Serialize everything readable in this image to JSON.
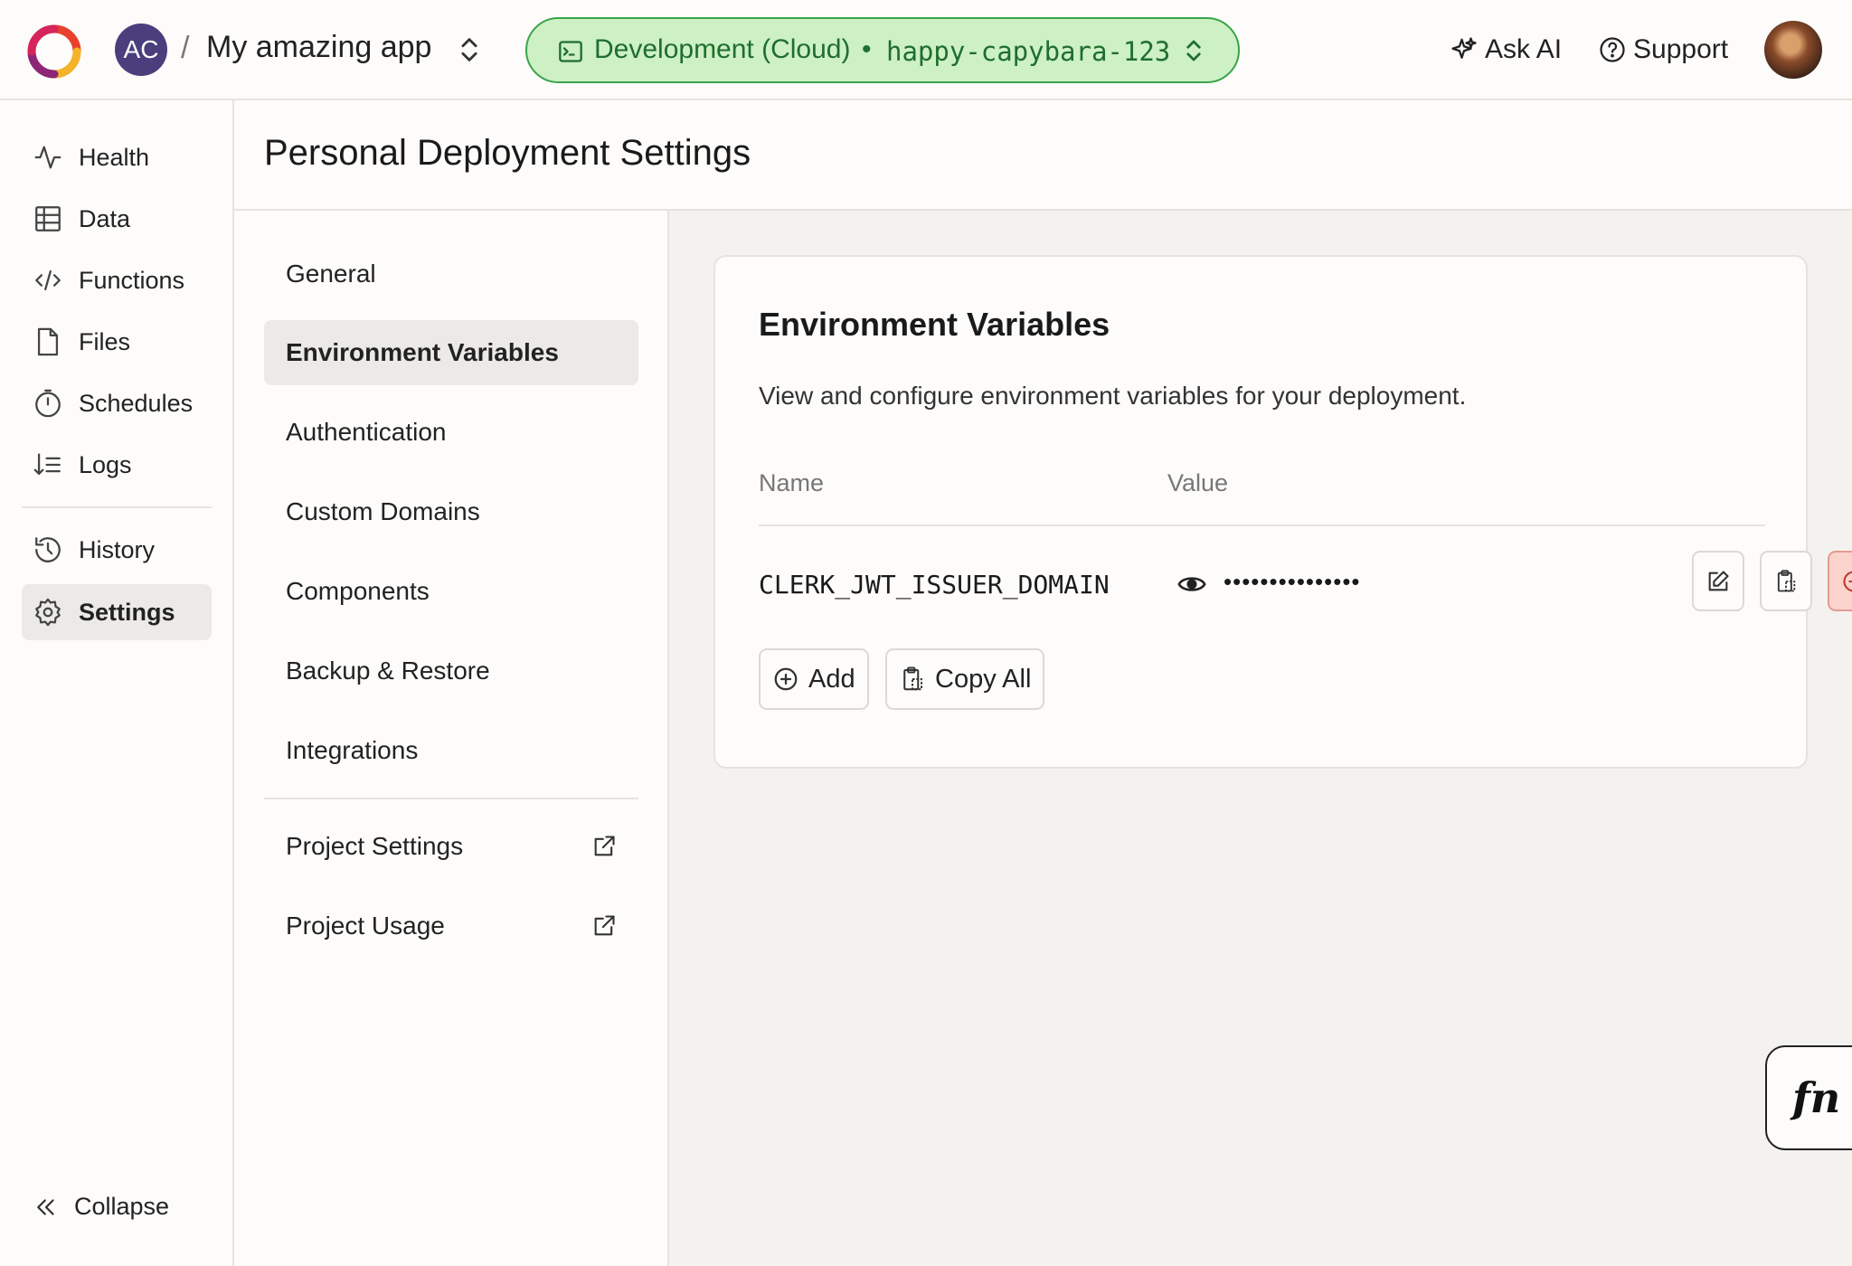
{
  "topbar": {
    "team_initials": "AC",
    "separator": "/",
    "project_name": "My amazing app",
    "deployment": {
      "environment": "Development (Cloud)",
      "bullet": "•",
      "slug": "happy-capybara-123",
      "colors": {
        "background": "#cdf0c5",
        "border": "#3aa348",
        "text": "#1f6e2c"
      }
    },
    "ask_ai_label": "Ask AI",
    "support_label": "Support"
  },
  "sidebar": {
    "items": [
      {
        "label": "Health",
        "icon": "activity-icon"
      },
      {
        "label": "Data",
        "icon": "table-icon"
      },
      {
        "label": "Functions",
        "icon": "code-icon"
      },
      {
        "label": "Files",
        "icon": "file-icon"
      },
      {
        "label": "Schedules",
        "icon": "stopwatch-icon"
      },
      {
        "label": "Logs",
        "icon": "logs-icon"
      },
      {
        "label": "History",
        "icon": "history-icon"
      },
      {
        "label": "Settings",
        "icon": "gear-icon",
        "active": true
      }
    ],
    "collapse_label": "Collapse"
  },
  "page": {
    "title": "Personal Deployment Settings"
  },
  "subnav": {
    "items": [
      {
        "label": "General"
      },
      {
        "label": "Environment Variables",
        "active": true
      },
      {
        "label": "Authentication"
      },
      {
        "label": "Custom Domains"
      },
      {
        "label": "Components"
      },
      {
        "label": "Backup & Restore"
      },
      {
        "label": "Integrations"
      }
    ],
    "external_items": [
      {
        "label": "Project Settings",
        "icon": "external-link-icon"
      },
      {
        "label": "Project Usage",
        "icon": "external-link-icon"
      }
    ]
  },
  "env_vars": {
    "title": "Environment Variables",
    "description": "View and configure environment variables for your deployment.",
    "columns": {
      "name": "Name",
      "value": "Value"
    },
    "rows": [
      {
        "name": "CLERK_JWT_ISSUER_DOMAIN",
        "masked_value": "•••••••••••••••"
      }
    ],
    "add_label": "Add",
    "copy_all_label": "Copy All",
    "danger_color": "#fbd3cd"
  },
  "fn_badge": "fn"
}
